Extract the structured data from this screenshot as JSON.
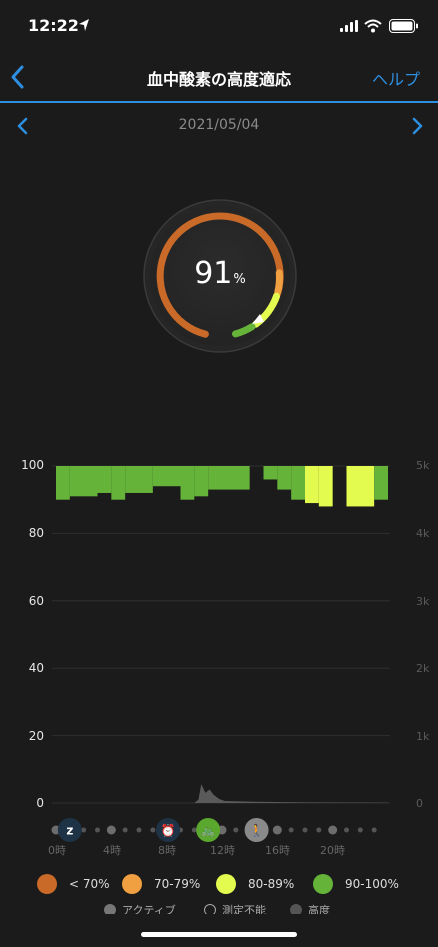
{
  "status_bar": {
    "time": "12:22"
  },
  "nav": {
    "title": "血中酸素の高度適応",
    "help": "ヘルプ"
  },
  "date": {
    "label": "2021/05/04"
  },
  "gauge": {
    "value": "91",
    "unit": "%"
  },
  "colors": {
    "lt70": "#c96a28",
    "r70_79": "#f0a040",
    "r80_89": "#e3fb4f",
    "r90_100": "#66b33a",
    "accent": "#2e8fe0"
  },
  "chart_data": {
    "type": "bar",
    "y_left": {
      "ticks": [
        "100",
        "80",
        "60",
        "40",
        "20",
        "0"
      ],
      "range": [
        0,
        100
      ]
    },
    "y_right": {
      "ticks": [
        "5k",
        "4k",
        "3k",
        "2k",
        "1k",
        "0"
      ],
      "range": [
        0,
        5000
      ]
    },
    "x_ticks": [
      "0時",
      "4時",
      "8時",
      "12時",
      "16時",
      "20時"
    ],
    "x_range_hours": [
      0,
      24
    ],
    "spo2_segments": [
      {
        "start_h": 0.0,
        "end_h": 1.0,
        "value": 90,
        "band": "90-100%"
      },
      {
        "start_h": 1.0,
        "end_h": 3.0,
        "value": 91,
        "band": "90-100%"
      },
      {
        "start_h": 3.0,
        "end_h": 4.0,
        "value": 92,
        "band": "90-100%"
      },
      {
        "start_h": 4.0,
        "end_h": 5.0,
        "value": 90,
        "band": "90-100%"
      },
      {
        "start_h": 5.0,
        "end_h": 7.0,
        "value": 92,
        "band": "90-100%"
      },
      {
        "start_h": 7.0,
        "end_h": 9.0,
        "value": 94,
        "band": "90-100%"
      },
      {
        "start_h": 9.0,
        "end_h": 10.0,
        "value": 90,
        "band": "90-100%"
      },
      {
        "start_h": 10.0,
        "end_h": 11.0,
        "value": 91,
        "band": "90-100%"
      },
      {
        "start_h": 11.0,
        "end_h": 14.0,
        "value": 93,
        "band": "90-100%"
      },
      {
        "start_h": 15.0,
        "end_h": 16.0,
        "value": 96,
        "band": "90-100%"
      },
      {
        "start_h": 16.0,
        "end_h": 17.0,
        "value": 93,
        "band": "90-100%"
      },
      {
        "start_h": 17.0,
        "end_h": 18.0,
        "value": 90,
        "band": "90-100%"
      },
      {
        "start_h": 18.0,
        "end_h": 19.0,
        "value": 89,
        "band": "80-89%"
      },
      {
        "start_h": 19.0,
        "end_h": 20.0,
        "value": 88,
        "band": "80-89%"
      },
      {
        "start_h": 21.0,
        "end_h": 23.0,
        "value": 88,
        "band": "80-89%"
      },
      {
        "start_h": 23.0,
        "end_h": 24.0,
        "value": 90,
        "band": "90-100%"
      }
    ],
    "altitude_m": [
      [
        0,
        0
      ],
      [
        10,
        0
      ],
      [
        10.3,
        50
      ],
      [
        10.5,
        280
      ],
      [
        10.8,
        150
      ],
      [
        11.1,
        200
      ],
      [
        11.4,
        120
      ],
      [
        11.8,
        60
      ],
      [
        12.2,
        30
      ],
      [
        14.0,
        20
      ],
      [
        18.0,
        10
      ],
      [
        24.0,
        5
      ]
    ]
  },
  "timeline": {
    "icons": [
      {
        "name": "sleep-icon",
        "glyph": "z",
        "hour": 1.0
      },
      {
        "name": "alarm-icon",
        "glyph": "⏰",
        "hour": 8.1
      },
      {
        "name": "bike-icon",
        "glyph": "🚲",
        "hour": 11.0
      },
      {
        "name": "walk-icon",
        "glyph": "🚶",
        "hour": 14.5
      }
    ]
  },
  "legend": [
    {
      "label": "< 70%",
      "color": "#c96a28"
    },
    {
      "label": "70-79%",
      "color": "#f0a040"
    },
    {
      "label": "80-89%",
      "color": "#e3fb4f"
    },
    {
      "label": "90-100%",
      "color": "#66b33a"
    }
  ],
  "legend2": [
    {
      "label": "アクティブ",
      "color": "#777"
    },
    {
      "label": "測定不能",
      "color": "transparent"
    },
    {
      "label": "高度",
      "color": "#555"
    }
  ]
}
